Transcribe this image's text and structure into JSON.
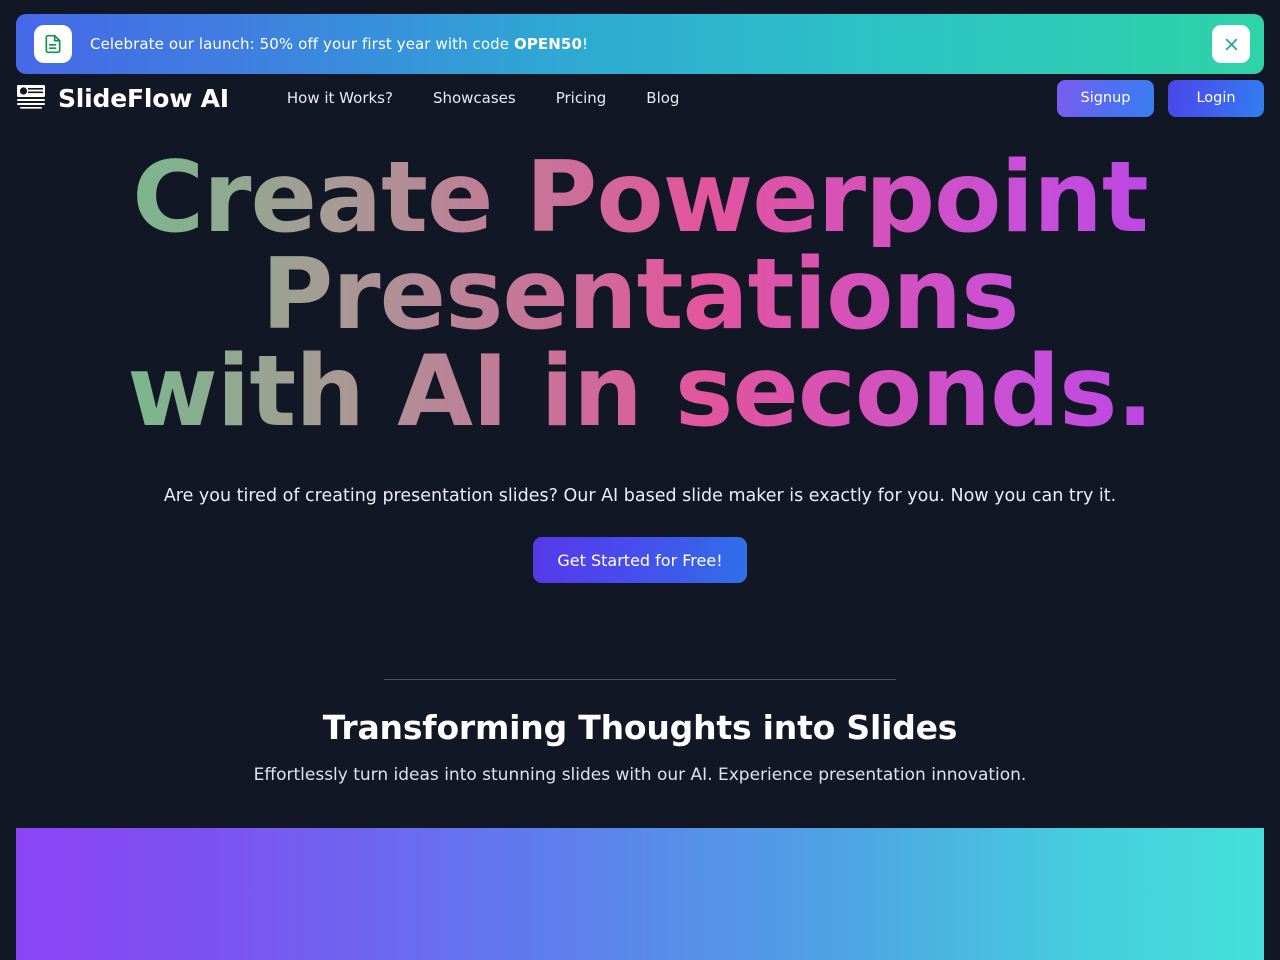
{
  "banner": {
    "icon": "document-icon",
    "message_prefix": "Celebrate our launch: 50% off your first year with code ",
    "promo_code": "OPEN50",
    "message_suffix": "!",
    "close_icon": "close-icon",
    "gradient_from": "#4668e8",
    "gradient_to": "#2fd3a8"
  },
  "navbar": {
    "logo_icon": "presentation-slide-icon",
    "brand": "SlideFlow AI",
    "links": [
      {
        "label": "How it Works?"
      },
      {
        "label": "Showcases"
      },
      {
        "label": "Pricing"
      },
      {
        "label": "Blog"
      }
    ],
    "signup_label": "Signup",
    "login_label": "Login",
    "signup_color": "#4f6ef2",
    "login_color": "#3f63ef"
  },
  "hero": {
    "title_lines": [
      "Create Powerpoint",
      "Presentations",
      "with AI in seconds."
    ],
    "subtitle": "Are you tired of creating presentation slides? Our AI based slide maker is exactly for you. Now you can try it.",
    "cta_label": "Get Started for Free!",
    "gradient_start": "#5ec98a",
    "gradient_mid": "#e2559c",
    "gradient_end": "#b23ff0"
  },
  "section": {
    "title": "Transforming Thoughts into Slides",
    "subtitle": "Effortlessly turn ideas into stunning slides with our AI. Experience presentation innovation."
  },
  "showcase": {
    "gradient_from": "#8b44f5",
    "gradient_to": "#44e0dc"
  },
  "page": {
    "background": "#121725"
  }
}
